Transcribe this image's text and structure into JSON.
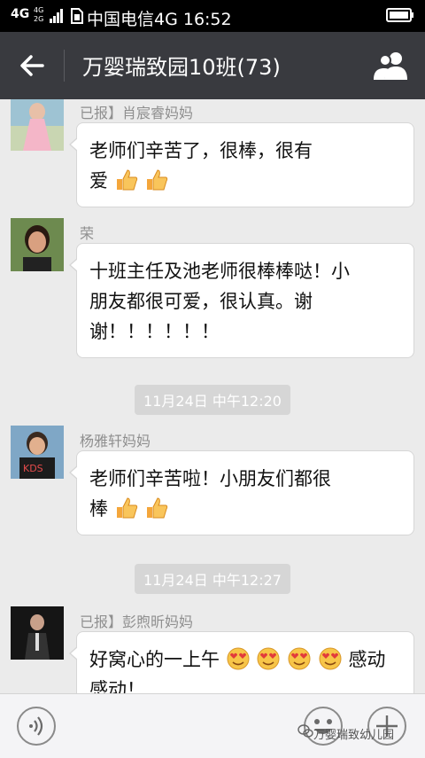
{
  "status_bar": {
    "network": "4G",
    "network_small": [
      "4G",
      "2G"
    ],
    "carrier_time": "中国电信4G 16:52"
  },
  "header": {
    "title": "万婴瑞致园10班(73)"
  },
  "messages": [
    {
      "type": "message",
      "sender": "已报】肖宸睿妈妈",
      "text_lines": [
        "老师们辛苦了，很棒，很有",
        "爱"
      ],
      "emojis": [
        "thumbs-up",
        "thumbs-up"
      ]
    },
    {
      "type": "message",
      "sender": "荣",
      "text_lines": [
        "十班主任及池老师很棒棒哒！小",
        "朋友都很可爱，很认真。谢",
        "谢！！！！！！"
      ],
      "emojis": []
    },
    {
      "type": "time",
      "text": "11月24日 中午12:20"
    },
    {
      "type": "message",
      "sender": "杨雅轩妈妈",
      "text_lines": [
        "老师们辛苦啦！小朋友们都很",
        "棒"
      ],
      "emojis": [
        "thumbs-up",
        "thumbs-up"
      ]
    },
    {
      "type": "time",
      "text": "11月24日 中午12:27"
    },
    {
      "type": "message",
      "sender": "已报】彭煦昕妈妈",
      "text_before": "好窝心的一上午",
      "emojis": [
        "heart-eyes",
        "heart-eyes",
        "heart-eyes",
        "heart-eyes"
      ],
      "text_after": "感动",
      "text_line2": "感动！"
    }
  ],
  "watermark": "万婴瑞致幼儿园",
  "colors": {
    "header_bg": "#393a3f",
    "chat_bg": "#ebebeb",
    "bubble_bg": "#ffffff",
    "time_pill_bg": "#d6d6d6"
  }
}
